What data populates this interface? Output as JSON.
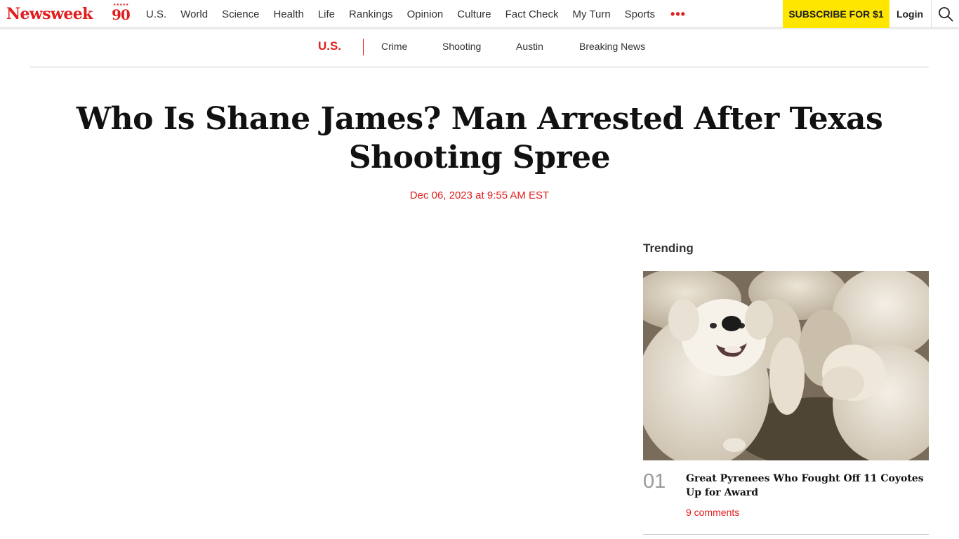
{
  "brand": {
    "name": "Newsweek",
    "badge": "90",
    "accent": "#e01e1e"
  },
  "nav": {
    "items": [
      "U.S.",
      "World",
      "Science",
      "Health",
      "Life",
      "Rankings",
      "Opinion",
      "Culture",
      "Fact Check",
      "My Turn",
      "Sports"
    ],
    "more_label": "•••",
    "subscribe_label": "SUBSCRIBE FOR $1",
    "login_label": "Login"
  },
  "section": {
    "category": "U.S.",
    "tags": [
      "Crime",
      "Shooting",
      "Austin",
      "Breaking News"
    ]
  },
  "article": {
    "headline": "Who Is Shane James? Man Arrested After Texas Shooting Spree",
    "date": "Dec 06, 2023 at 9:55 AM EST"
  },
  "sidebar": {
    "title": "Trending",
    "items": [
      {
        "rank": "01",
        "headline": "Great Pyrenees Who Fought Off 11 Coyotes Up for Award",
        "comments": "9 comments"
      }
    ]
  }
}
